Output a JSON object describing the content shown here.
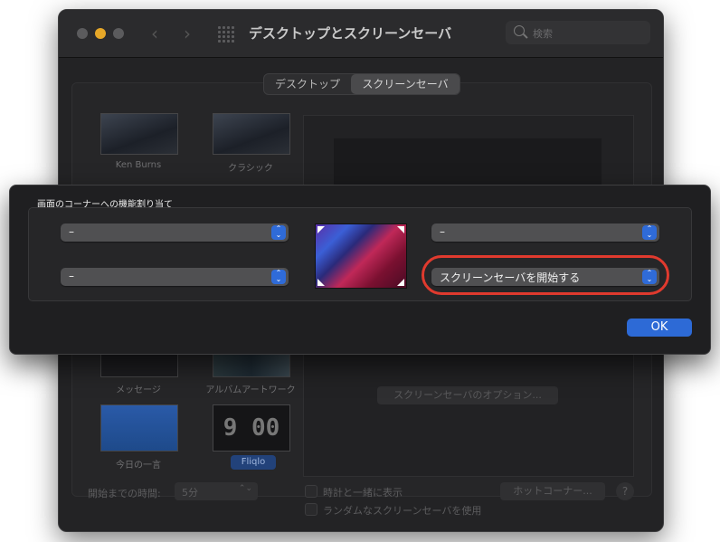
{
  "window": {
    "title": "デスクトップとスクリーンセーバ",
    "search_placeholder": "検索"
  },
  "tabs": [
    {
      "label": "デスクトップ",
      "selected": false
    },
    {
      "label": "スクリーンセーバ",
      "selected": true
    }
  ],
  "savers": [
    {
      "label": "Ken Burns"
    },
    {
      "label": "クラシック"
    },
    {
      "label": "メッセージ"
    },
    {
      "label": "アルバムアートワーク"
    },
    {
      "label": "今日の一言"
    },
    {
      "label": "Fliqlo",
      "selected": true
    }
  ],
  "fliqlo_time": "9 00",
  "options_button": "スクリーンセーバのオプション...",
  "bottom": {
    "start_label": "開始までの時間:",
    "start_value": "5分",
    "show_clock": "時計と一緒に表示",
    "random": "ランダムなスクリーンセーバを使用",
    "hot_corners": "ホットコーナー...",
    "help": "?"
  },
  "sheet": {
    "title": "画面のコーナーへの機能割り当て",
    "top_left": "–",
    "bottom_left": "–",
    "top_right": "–",
    "bottom_right": "スクリーンセーバを開始する",
    "ok": "OK"
  },
  "colors": {
    "accent": "#2d6ad6",
    "highlight": "#e03a2e",
    "window_bg": "#232325"
  }
}
